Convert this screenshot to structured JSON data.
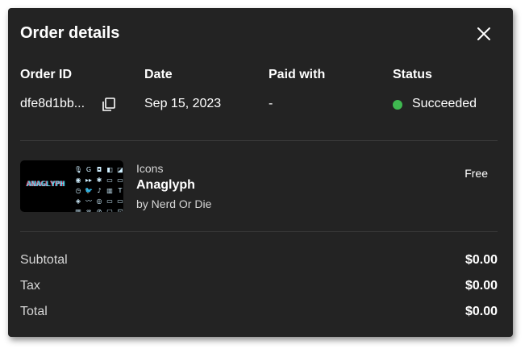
{
  "dialog": {
    "title": "Order details",
    "close_icon": "close-icon"
  },
  "order": {
    "headers": {
      "order_id": "Order ID",
      "date": "Date",
      "paid_with": "Paid with",
      "status": "Status"
    },
    "values": {
      "order_id": "dfe8d1bb...",
      "date": "Sep 15, 2023",
      "paid_with": "-",
      "status": "Succeeded"
    },
    "status_color": "#3fb950",
    "copy_icon": "copy-icon"
  },
  "item": {
    "category": "Icons",
    "name": "Anaglyph",
    "author": "by Nerd Or Die",
    "price": "Free",
    "thumbnail_text": "ANAGLYPH",
    "thumbnail_icons": [
      "🎙",
      "G",
      "◘",
      "◧",
      "◪",
      "◉",
      "▸▸",
      "✱",
      "▭",
      "▭",
      "◷",
      "🐦",
      "♪",
      "▥",
      "T",
      "◈",
      "〰",
      "◎",
      "▭",
      "▭",
      "▥",
      "♒",
      "⊘",
      "▢",
      "⊡"
    ]
  },
  "summary": {
    "subtotal_label": "Subtotal",
    "subtotal_value": "$0.00",
    "tax_label": "Tax",
    "tax_value": "$0.00",
    "total_label": "Total",
    "total_value": "$0.00"
  }
}
